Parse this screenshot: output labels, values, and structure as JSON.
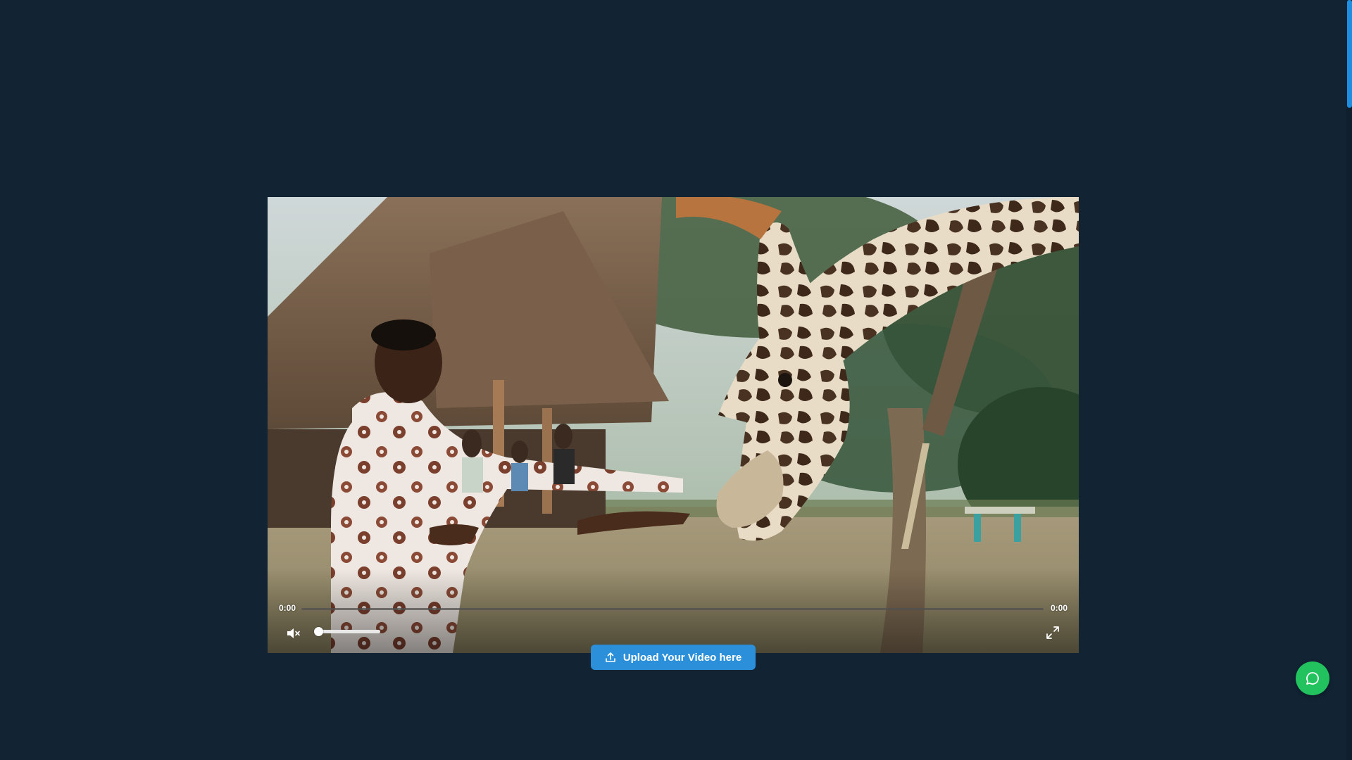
{
  "video": {
    "current_time": "0:00",
    "duration": "0:00",
    "progress_fraction": 0,
    "volume_fraction": 0,
    "muted": true,
    "mute_icon": "volume-muted-icon",
    "fullscreen_icon": "fullscreen-icon",
    "frame_description_icon": "video-frame"
  },
  "upload": {
    "label": "Upload Your Video here",
    "icon": "upload-icon"
  },
  "chat": {
    "icon": "chat-bubble-icon",
    "color": "#22c35e"
  },
  "colors": {
    "background": "#122334",
    "accent": "#2b90d9",
    "scrollbar_thumb": "#1e8fe0"
  }
}
